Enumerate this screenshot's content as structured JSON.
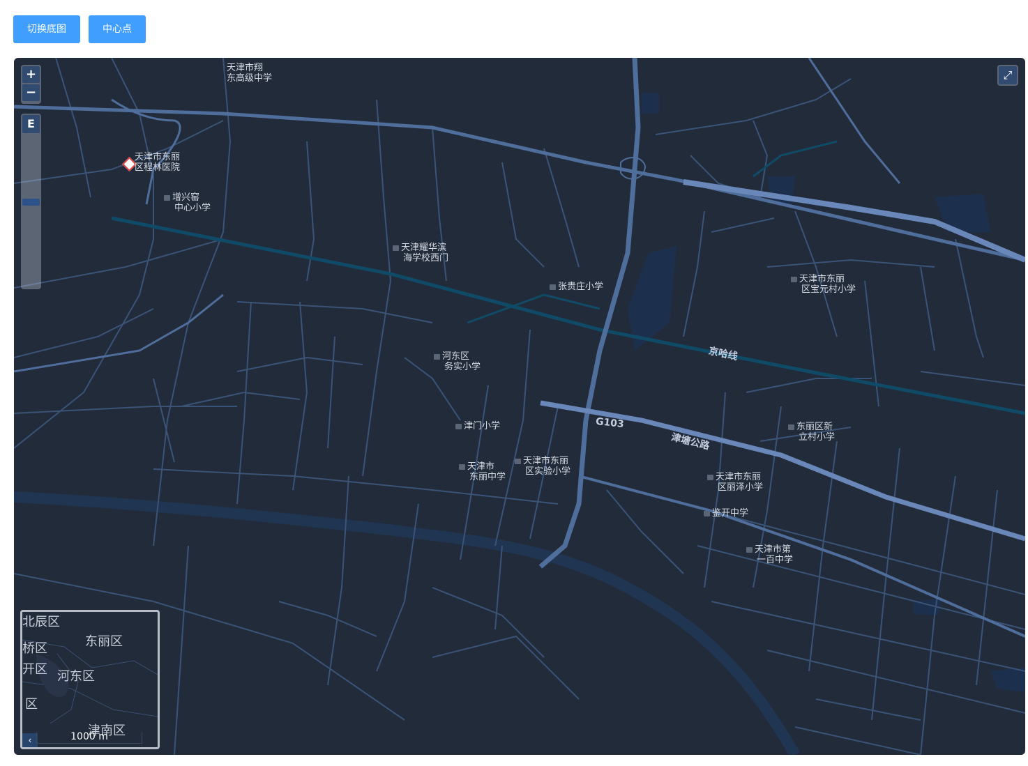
{
  "toolbar": {
    "switch_basemap": "切换底图",
    "center_point": "中心点"
  },
  "controls": {
    "zoom_in": "+",
    "zoom_out": "−",
    "slider_top": "E",
    "fullscreen": "⤢",
    "overview_toggle": "‹"
  },
  "scale": {
    "label": "1000 m"
  },
  "colors": {
    "background": "#222b3a",
    "roads": "#3f5a80",
    "major_roads": "#5b7cab",
    "railway": "#0f4a66",
    "button": "#409eff"
  },
  "roads": {
    "g103": "G103",
    "jintang": "津塘公路",
    "jingha": "京哈线"
  },
  "pois": {
    "p1": [
      "天津市翔",
      "东高级中学"
    ],
    "p2": [
      "天津市东丽",
      "区程林医院"
    ],
    "p3": [
      "增兴窑",
      "中心小学"
    ],
    "p4": [
      "天津耀华滨",
      "海学校西门"
    ],
    "p5": [
      "张贵庄小学"
    ],
    "p6": [
      "天津市东丽",
      "区宝元村小学"
    ],
    "p7": [
      "河东区",
      "务实小学"
    ],
    "p8": [
      "津门小学"
    ],
    "p9": [
      "东丽区新",
      "立村小学"
    ],
    "p10": [
      "天津市",
      "东丽中学"
    ],
    "p11": [
      "天津市东丽",
      "区实验小学"
    ],
    "p12": [
      "天津市东丽",
      "区丽泽小学"
    ],
    "p13": [
      "鉴开中学"
    ],
    "p14": [
      "天津市第",
      "一百中学"
    ]
  },
  "overview": {
    "districts": [
      "北辰区",
      "东丽区",
      "桥区",
      "开区",
      "河东区",
      "区",
      "津南区"
    ]
  }
}
